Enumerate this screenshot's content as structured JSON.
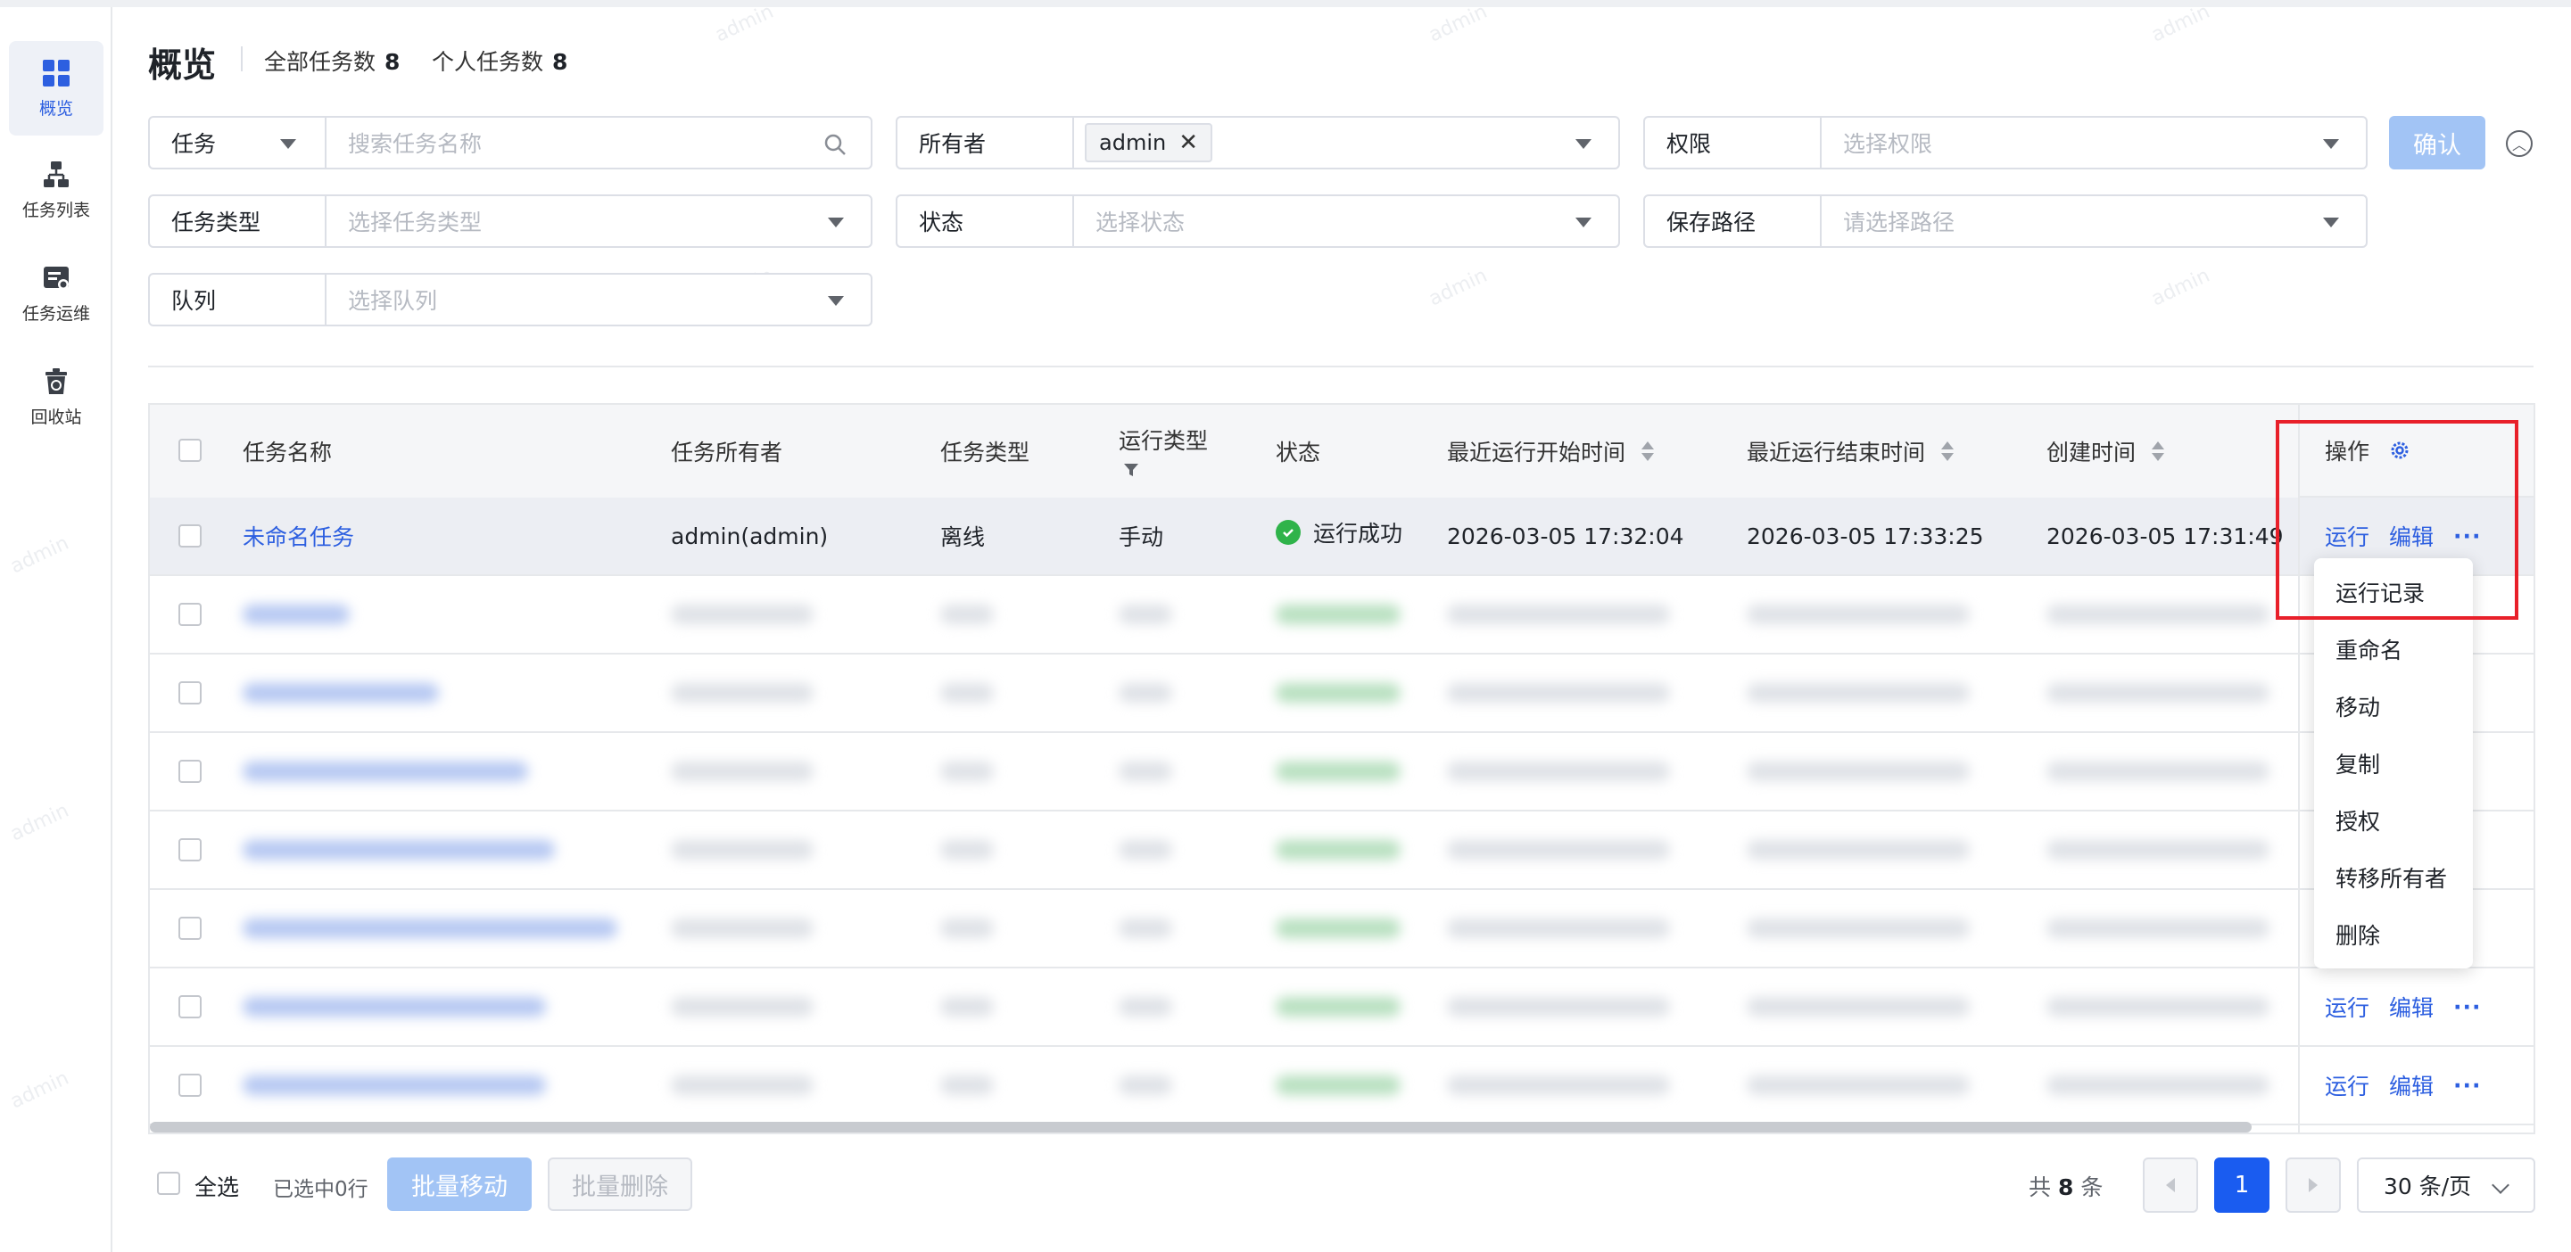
{
  "sidebar": {
    "items": [
      {
        "label": "概览",
        "icon": "grid-icon",
        "active": true
      },
      {
        "label": "任务列表",
        "icon": "hierarchy-icon",
        "active": false
      },
      {
        "label": "任务运维",
        "icon": "ops-icon",
        "active": false
      },
      {
        "label": "回收站",
        "icon": "recycle-bin-icon",
        "active": false
      }
    ]
  },
  "header": {
    "title": "概览",
    "total_label": "全部任务数",
    "total_value": "8",
    "personal_label": "个人任务数",
    "personal_value": "8"
  },
  "filters": {
    "task_select": "任务",
    "task_search_placeholder": "搜索任务名称",
    "owner_label": "所有者",
    "owner_tag": "admin",
    "permission_label": "权限",
    "permission_placeholder": "选择权限",
    "task_type_label": "任务类型",
    "task_type_placeholder": "选择任务类型",
    "status_label": "状态",
    "status_placeholder": "选择状态",
    "path_label": "保存路径",
    "path_placeholder": "请选择路径",
    "queue_label": "队列",
    "queue_placeholder": "选择队列",
    "confirm_label": "确认"
  },
  "table": {
    "columns": [
      "任务名称",
      "任务所有者",
      "任务类型",
      "运行类型",
      "状态",
      "最近运行开始时间",
      "最近运行结束时间",
      "创建时间",
      "操作"
    ],
    "rows": [
      {
        "name": "未命名任务",
        "owner": "admin(admin)",
        "type": "离线",
        "run_type": "手动",
        "status": "运行成功",
        "start": "2026-03-05 17:32:04",
        "end": "2026-03-05 17:33:25",
        "created": "2026-03-05 17:31:49"
      }
    ],
    "actions": {
      "run": "运行",
      "edit": "编辑",
      "more": "···"
    }
  },
  "more_menu": [
    "运行记录",
    "重命名",
    "移动",
    "复制",
    "授权",
    "转移所有者",
    "删除"
  ],
  "footer": {
    "select_all": "全选",
    "selected_text": "已选中0行",
    "batch_move": "批量移动",
    "batch_delete": "批量删除",
    "total_prefix": "共",
    "total_count": "8",
    "total_suffix": "条",
    "current_page": "1",
    "page_size": "30 条/页"
  },
  "watermark": "admin",
  "colors": {
    "accent": "#2d5fe0",
    "success": "#2fb34a",
    "highlight": "#e8202a"
  }
}
